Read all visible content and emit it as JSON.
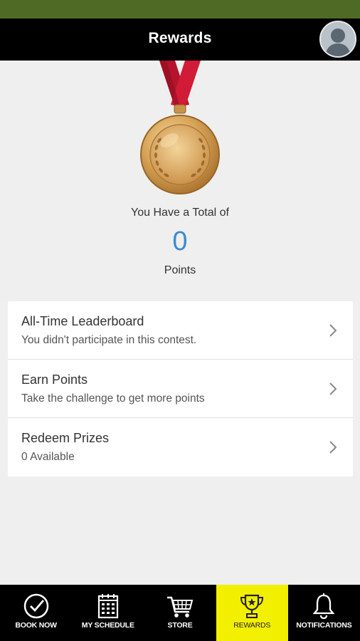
{
  "header": {
    "title": "Rewards",
    "avatar_icon": "user-avatar-icon"
  },
  "summary": {
    "caption": "You Have a Total of",
    "points": "0",
    "unit": "Points",
    "medal_icon": "gold-medal-icon",
    "points_color": "#3a8bd1"
  },
  "menu": {
    "items": [
      {
        "title": "All-Time Leaderboard",
        "subtitle": "You didn't participate in this contest."
      },
      {
        "title": "Earn Points",
        "subtitle": "Take the challenge to get more points"
      },
      {
        "title": "Redeem Prizes",
        "subtitle": "0 Available"
      }
    ]
  },
  "nav": {
    "items": [
      {
        "label": "BOOK NOW",
        "icon": "check-circle-icon"
      },
      {
        "label": "MY SCHEDULE",
        "icon": "calendar-icon"
      },
      {
        "label": "STORE",
        "icon": "cart-icon"
      },
      {
        "label": "REWARDS",
        "icon": "trophy-icon",
        "active": true
      },
      {
        "label": "NOTIFICATIONS",
        "icon": "bell-icon"
      }
    ],
    "active_color": "#f3ef00"
  },
  "colors": {
    "status_bar": "#4e6a24",
    "header_bg": "#000000",
    "background": "#efefef"
  }
}
